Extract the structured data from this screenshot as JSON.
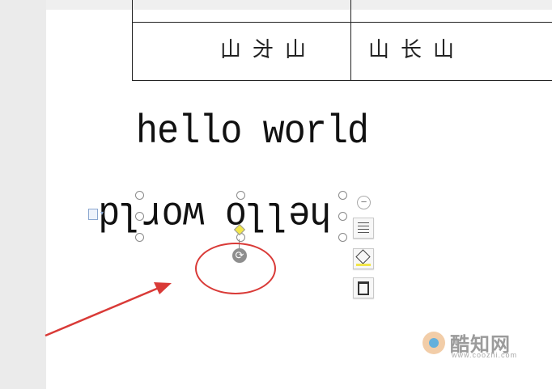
{
  "table": {
    "left_cell_text": "山长山",
    "right_cell_text": "山长山"
  },
  "document": {
    "text_normal": "hello world",
    "text_flipped": "hello world"
  },
  "side_toolbar": {
    "collapse_symbol": "−",
    "layout_icon": "layout-options-icon",
    "fill_icon": "fill-color-icon",
    "border_icon": "border-outline-icon"
  },
  "rotate_handle_symbol": "⟳",
  "watermark": {
    "brand": "酷知网",
    "url": "www.coozhi.com"
  },
  "colors": {
    "annotation_red": "#d93a37",
    "handle_yellow": "#f2e64a",
    "paragraph_blue": "#8aa6cf"
  }
}
